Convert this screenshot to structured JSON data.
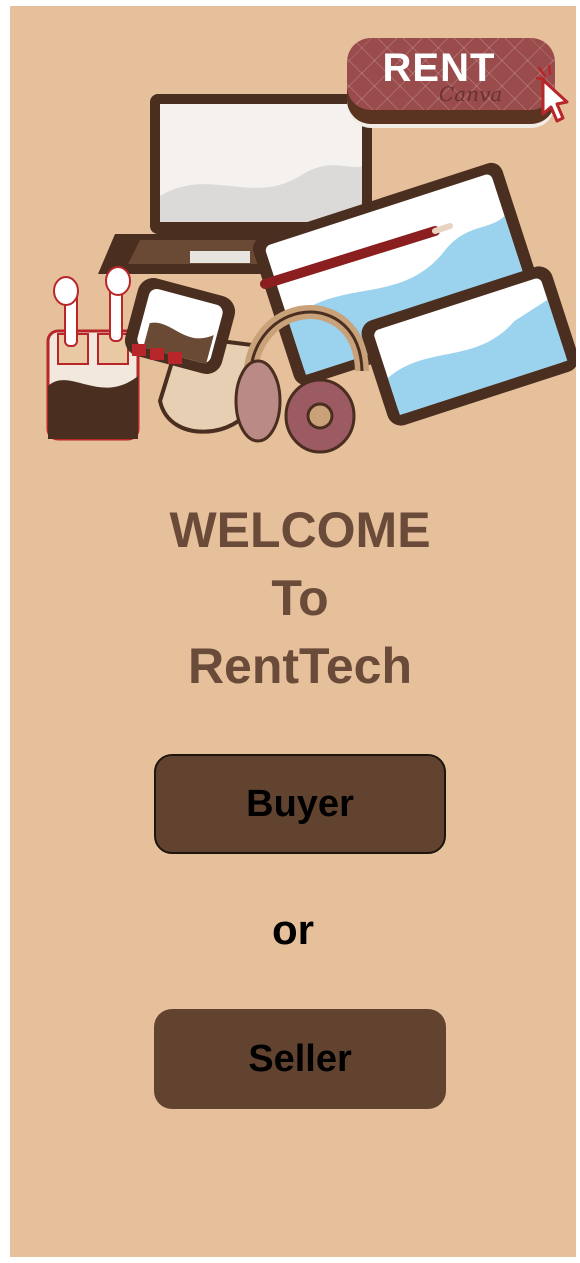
{
  "rent_badge": {
    "label": "RENT",
    "watermark": "Canva",
    "icon": "cursor-click-icon"
  },
  "hero": {
    "icons": [
      "laptop-icon",
      "tablet-icon",
      "phone-icon",
      "stylus-icon",
      "earbuds-icon",
      "smartwatch-icon",
      "headphones-icon"
    ]
  },
  "welcome": {
    "line1": "WELCOME",
    "line2": "To",
    "line3": "RentTech"
  },
  "buttons": {
    "buyer": "Buyer",
    "or": "or",
    "seller": "Seller"
  },
  "colors": {
    "background": "#e5c09b",
    "heading": "#6a4a38",
    "button": "#62432f",
    "button_text": "#000000",
    "badge": "#9a4b4b"
  }
}
